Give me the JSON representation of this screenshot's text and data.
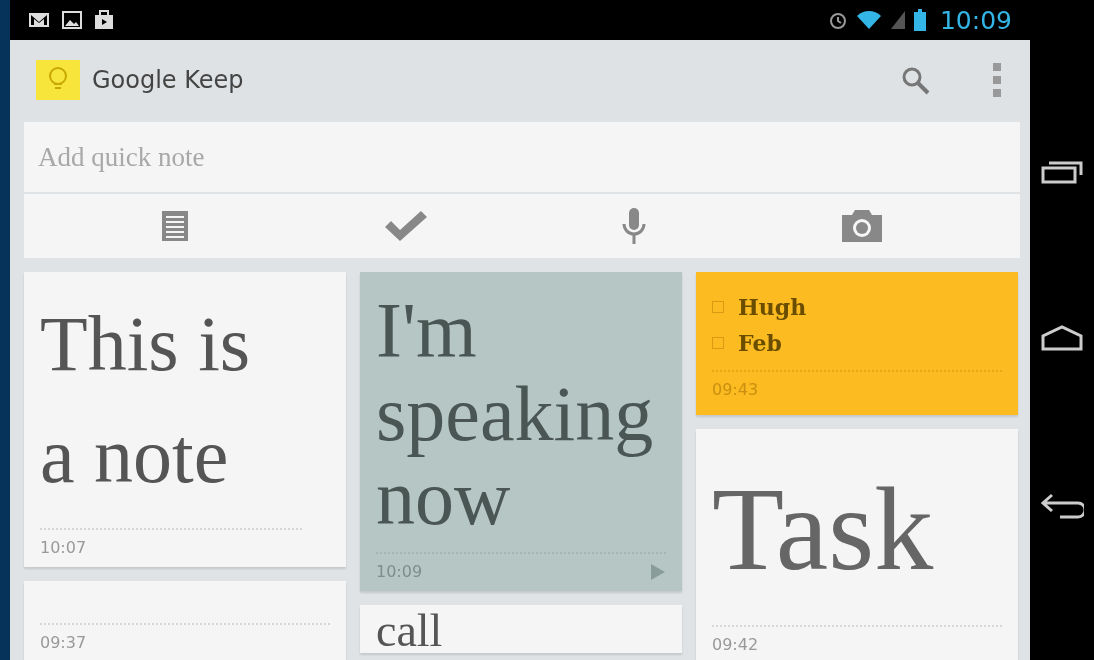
{
  "status_bar": {
    "time": "10:09"
  },
  "app_bar": {
    "title": "Google Keep"
  },
  "quick_note": {
    "placeholder": "Add quick note"
  },
  "columns": [
    {
      "notes": [
        {
          "kind": "text",
          "color": "#f5f5f5",
          "text": "This is a note",
          "time": "10:07"
        },
        {
          "kind": "text",
          "color": "#f5f5f5",
          "time": "09:37"
        }
      ]
    },
    {
      "notes": [
        {
          "kind": "voice",
          "color": "#b6c6c4",
          "text": "I'm speaking now",
          "time": "10:09"
        },
        {
          "kind": "text",
          "color": "#f5f5f5",
          "text": "call"
        }
      ]
    },
    {
      "notes": [
        {
          "kind": "checklist",
          "color": "#fbbb21",
          "items": [
            {
              "text": "Hugh",
              "checked": false
            },
            {
              "text": "Feb",
              "checked": false
            }
          ],
          "time": "09:43"
        },
        {
          "kind": "text",
          "color": "#f5f5f5",
          "text": "Task",
          "time": "09:42"
        }
      ]
    }
  ]
}
